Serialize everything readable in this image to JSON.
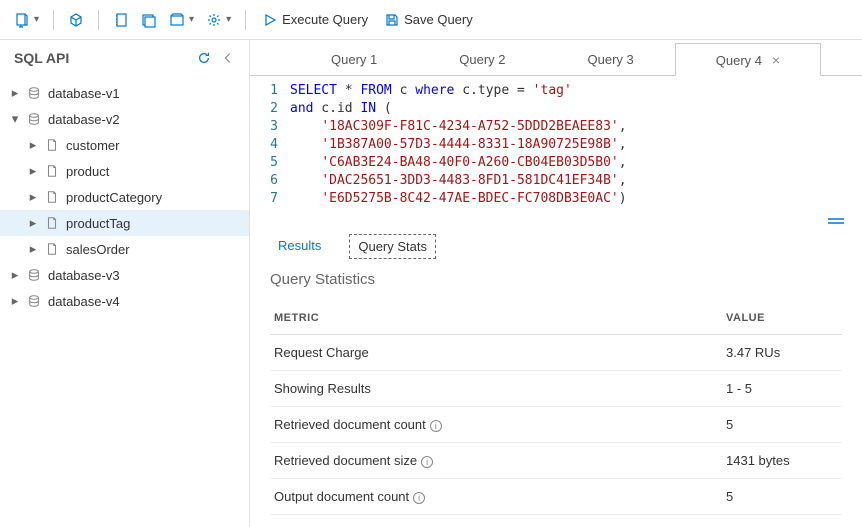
{
  "toolbar": {
    "execute_label": "Execute Query",
    "save_label": "Save Query"
  },
  "sidebar": {
    "title": "SQL API",
    "items": [
      {
        "kind": "db",
        "label": "database-v1",
        "expanded": false,
        "indent": 0
      },
      {
        "kind": "db",
        "label": "database-v2",
        "expanded": true,
        "indent": 0
      },
      {
        "kind": "coll",
        "label": "customer",
        "indent": 1
      },
      {
        "kind": "coll",
        "label": "product",
        "indent": 1
      },
      {
        "kind": "coll",
        "label": "productCategory",
        "indent": 1
      },
      {
        "kind": "coll",
        "label": "productTag",
        "indent": 1,
        "selected": true
      },
      {
        "kind": "coll",
        "label": "salesOrder",
        "indent": 1
      },
      {
        "kind": "db",
        "label": "database-v3",
        "expanded": false,
        "indent": 0
      },
      {
        "kind": "db",
        "label": "database-v4",
        "expanded": false,
        "indent": 0
      }
    ]
  },
  "tabs": [
    {
      "label": "Query 1"
    },
    {
      "label": "Query 2"
    },
    {
      "label": "Query 3"
    },
    {
      "label": "Query 4",
      "active": true,
      "closable": true
    }
  ],
  "editor": {
    "lines": [
      {
        "n": 1,
        "tokens": [
          {
            "t": "SELECT",
            "c": "kw"
          },
          {
            "t": " * "
          },
          {
            "t": "FROM",
            "c": "kw"
          },
          {
            "t": " c "
          },
          {
            "t": "where",
            "c": "kw"
          },
          {
            "t": " c.type = "
          },
          {
            "t": "'tag'",
            "c": "str"
          }
        ]
      },
      {
        "n": 2,
        "tokens": [
          {
            "t": "and",
            "c": "kw"
          },
          {
            "t": " c.id "
          },
          {
            "t": "IN",
            "c": "kw"
          },
          {
            "t": " ("
          }
        ]
      },
      {
        "n": 3,
        "tokens": [
          {
            "t": "    "
          },
          {
            "t": "'18AC309F-F81C-4234-A752-5DDD2BEAEE83'",
            "c": "str"
          },
          {
            "t": ","
          }
        ]
      },
      {
        "n": 4,
        "tokens": [
          {
            "t": "    "
          },
          {
            "t": "'1B387A00-57D3-4444-8331-18A90725E98B'",
            "c": "str"
          },
          {
            "t": ","
          }
        ]
      },
      {
        "n": 5,
        "tokens": [
          {
            "t": "    "
          },
          {
            "t": "'C6AB3E24-BA48-40F0-A260-CB04EB03D5B0'",
            "c": "str"
          },
          {
            "t": ","
          }
        ]
      },
      {
        "n": 6,
        "tokens": [
          {
            "t": "    "
          },
          {
            "t": "'DAC25651-3DD3-4483-8FD1-581DC41EF34B'",
            "c": "str"
          },
          {
            "t": ","
          }
        ]
      },
      {
        "n": 7,
        "tokens": [
          {
            "t": "    "
          },
          {
            "t": "'E6D5275B-8C42-47AE-BDEC-FC708DB3E0AC'",
            "c": "str"
          },
          {
            "t": ")"
          }
        ]
      }
    ]
  },
  "subtabs": {
    "results_label": "Results",
    "stats_label": "Query Stats"
  },
  "stats": {
    "title": "Query Statistics",
    "header_metric": "METRIC",
    "header_value": "VALUE",
    "rows": [
      {
        "metric": "Request Charge",
        "value": "3.47 RUs",
        "info": false
      },
      {
        "metric": "Showing Results",
        "value": "1 - 5",
        "info": false
      },
      {
        "metric": "Retrieved document count",
        "value": "5",
        "info": true
      },
      {
        "metric": "Retrieved document size",
        "value": "1431 bytes",
        "info": true
      },
      {
        "metric": "Output document count",
        "value": "5",
        "info": true
      }
    ]
  }
}
